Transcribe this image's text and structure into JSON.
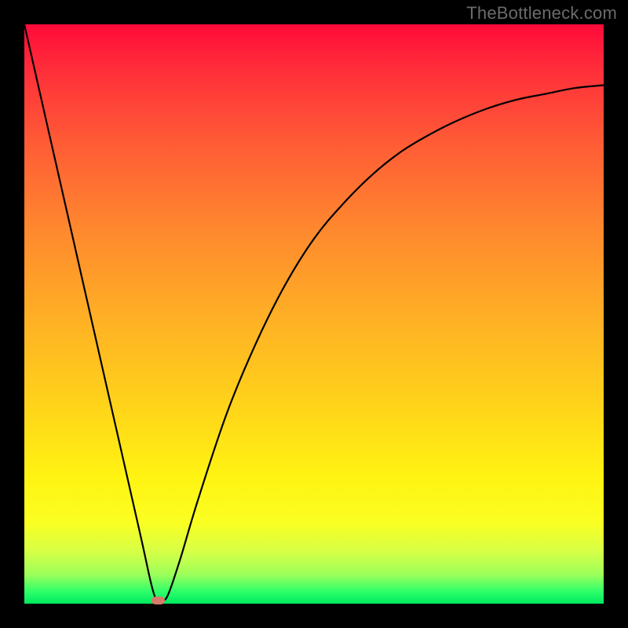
{
  "watermark": "TheBottleneck.com",
  "chart_data": {
    "type": "line",
    "title": "",
    "xlabel": "",
    "ylabel": "",
    "xlim": [
      0,
      100
    ],
    "ylim": [
      0,
      100
    ],
    "grid": false,
    "legend": false,
    "series": [
      {
        "name": "bottleneck-curve",
        "x": [
          0,
          5,
          10,
          15,
          20,
          22,
          23,
          24,
          25,
          27,
          30,
          35,
          40,
          45,
          50,
          55,
          60,
          65,
          70,
          75,
          80,
          85,
          90,
          95,
          100
        ],
        "values": [
          100,
          78,
          56,
          34,
          12,
          3,
          0.5,
          0.5,
          2,
          8,
          18,
          33,
          45,
          55,
          63,
          69,
          74,
          78,
          81,
          83.5,
          85.5,
          87,
          88,
          89,
          89.5
        ]
      }
    ],
    "annotations": [
      {
        "name": "min-marker",
        "x": 23,
        "y": 0.5
      }
    ],
    "background_gradient": {
      "direction": "vertical",
      "stops": [
        {
          "pos": 0.0,
          "color": "#ff0a3a"
        },
        {
          "pos": 0.2,
          "color": "#ff5a36"
        },
        {
          "pos": 0.52,
          "color": "#ffb324"
        },
        {
          "pos": 0.78,
          "color": "#fff312"
        },
        {
          "pos": 1.0,
          "color": "#00e85e"
        }
      ]
    }
  }
}
